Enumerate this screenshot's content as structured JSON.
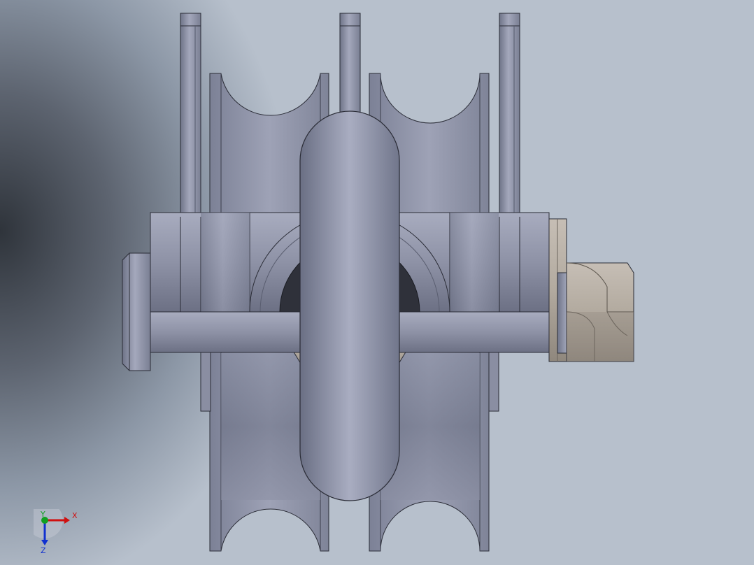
{
  "viewport": {
    "background_dark": "#2f343b",
    "background_light": "#c3cad4",
    "part_color": "#8a8fa4",
    "hardware_color": "#b8b0a6"
  },
  "model": {
    "components": [
      "sheave-left",
      "sheave-right",
      "side-plate-left",
      "side-plate-center",
      "side-plate-right",
      "shackle-bow",
      "axle-pin",
      "hex-nut",
      "washer"
    ]
  },
  "triad": {
    "x_label": "X",
    "y_label": "Y",
    "z_label": "Z",
    "x_color": "#d01010",
    "y_color": "#10a020",
    "z_color": "#1030d0"
  }
}
